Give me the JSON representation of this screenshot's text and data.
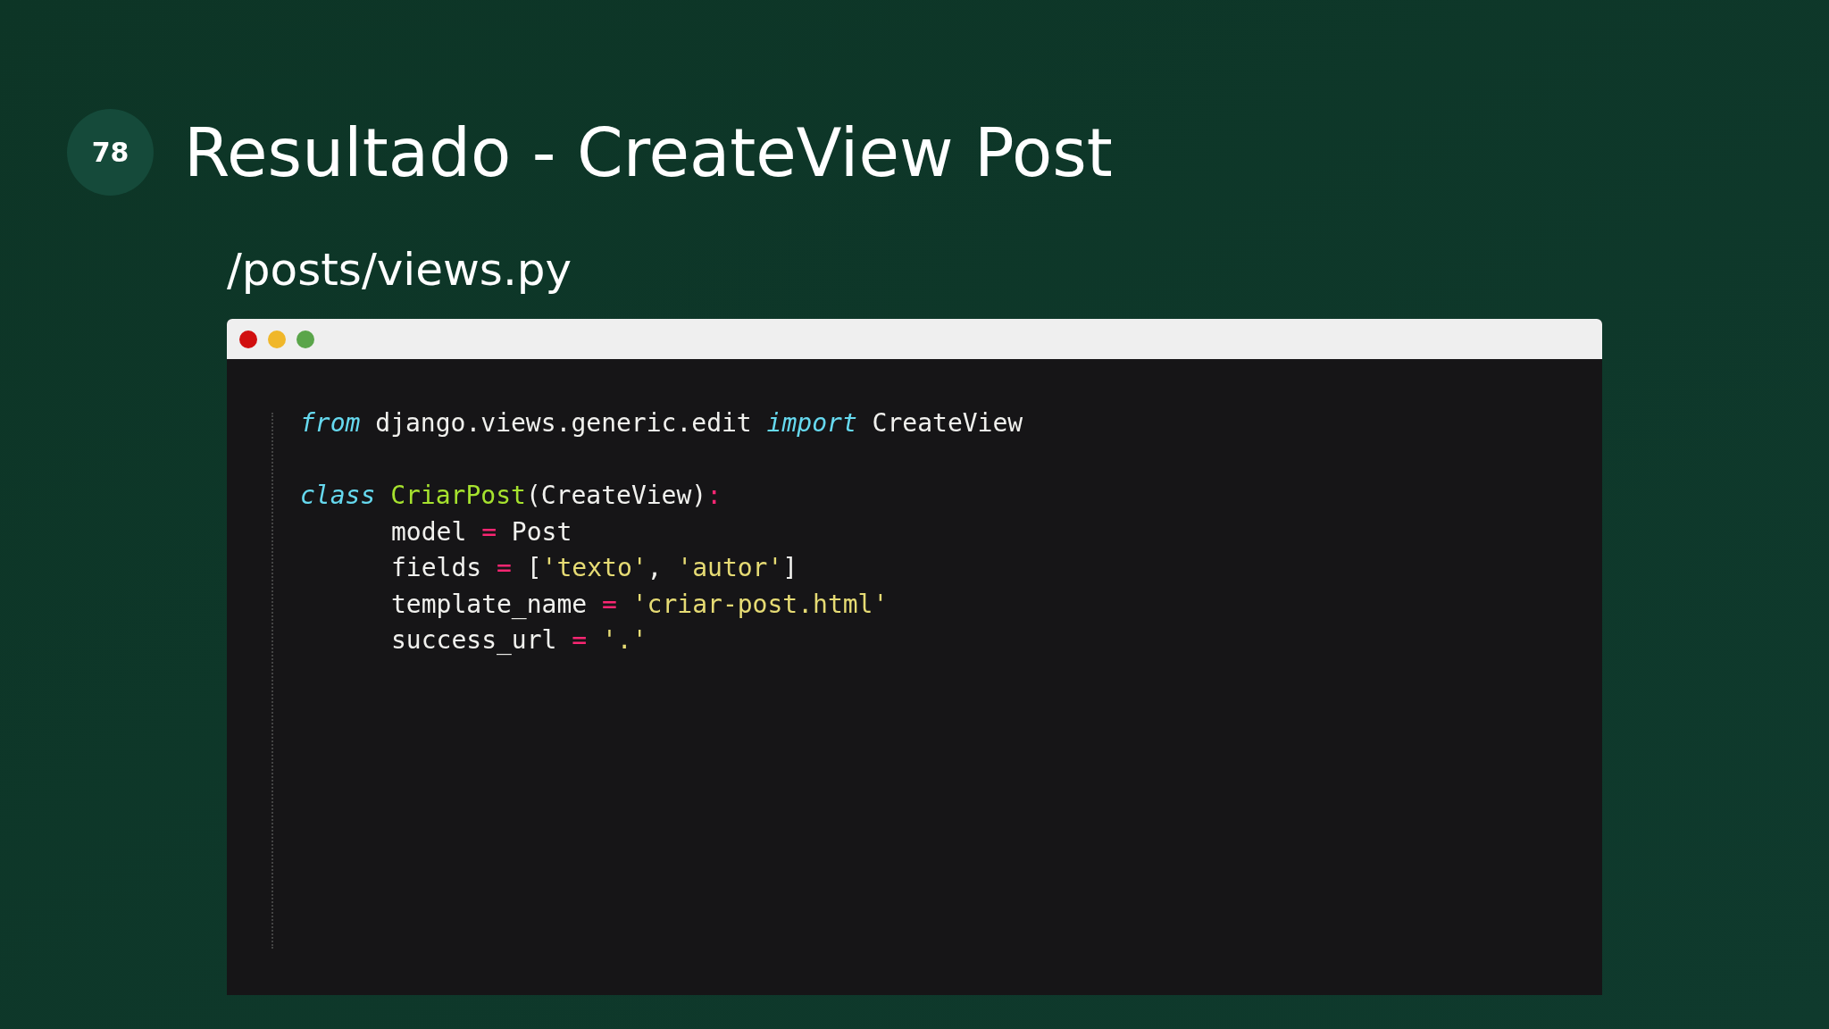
{
  "slide_number": "78",
  "title": "Resultado - CreateView Post",
  "subtitle": "/posts/views.py",
  "window": {
    "dots": [
      {
        "color": "#d10f0f"
      },
      {
        "color": "#f0b72a"
      },
      {
        "color": "#5aa54a"
      }
    ]
  },
  "code": [
    {
      "indent": false,
      "tokens": [
        {
          "kind": "keyword",
          "text": "from"
        },
        {
          "kind": "plain",
          "text": " django.views.generic.edit "
        },
        {
          "kind": "keyword",
          "text": "import"
        },
        {
          "kind": "plain",
          "text": " CreateView"
        }
      ]
    },
    {
      "indent": false
    },
    {
      "indent": false,
      "tokens": [
        {
          "kind": "keyword",
          "text": "class"
        },
        {
          "kind": "name",
          "text": " CriarPost"
        },
        {
          "kind": "plain",
          "text": "(CreateView)"
        },
        {
          "kind": "operator",
          "text": ":"
        }
      ]
    },
    {
      "indent": true,
      "tokens": [
        {
          "kind": "plain",
          "text": "model "
        },
        {
          "kind": "operator",
          "text": "="
        },
        {
          "kind": "plain",
          "text": " Post"
        }
      ]
    },
    {
      "indent": true,
      "tokens": [
        {
          "kind": "plain",
          "text": "fields "
        },
        {
          "kind": "operator",
          "text": "="
        },
        {
          "kind": "plain",
          "text": " ["
        },
        {
          "kind": "string",
          "text": "'texto'"
        },
        {
          "kind": "plain",
          "text": ", "
        },
        {
          "kind": "string",
          "text": "'autor'"
        },
        {
          "kind": "plain",
          "text": "]"
        }
      ]
    },
    {
      "indent": true,
      "tokens": [
        {
          "kind": "plain",
          "text": "template_name "
        },
        {
          "kind": "operator",
          "text": "="
        },
        {
          "kind": "string",
          "text": " 'criar-post.html'"
        }
      ]
    },
    {
      "indent": true,
      "tokens": [
        {
          "kind": "plain",
          "text": "success_url "
        },
        {
          "kind": "operator",
          "text": "="
        },
        {
          "kind": "string",
          "text": " '.'"
        }
      ]
    }
  ]
}
